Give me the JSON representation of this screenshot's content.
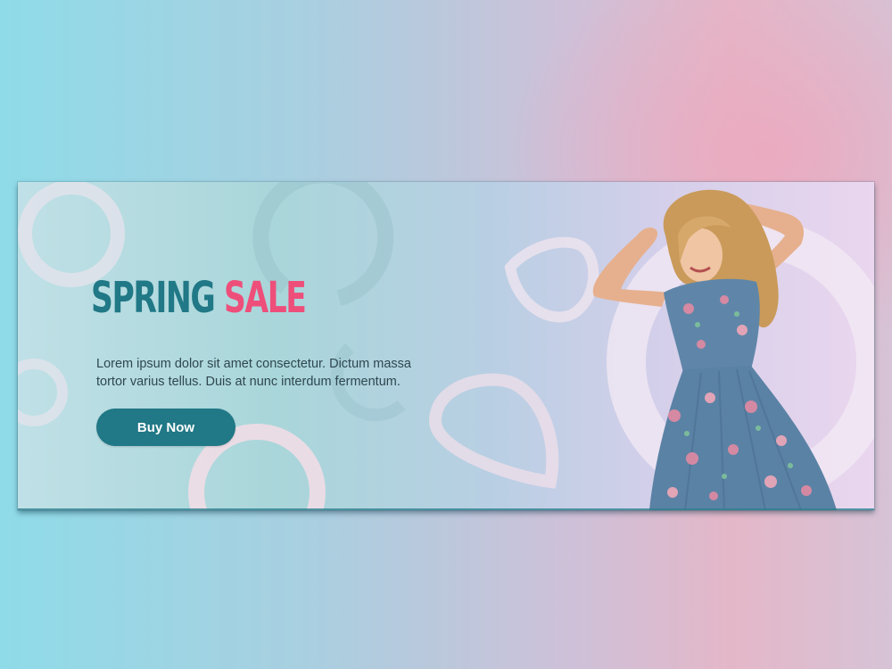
{
  "banner": {
    "headline_part1": "SPRING",
    "headline_part2": "SALE",
    "body_text": "Lorem ipsum dolor sit amet consectetur. Dictum massa tortor varius tellus. Duis at nunc interdum fermentum.",
    "cta_label": "Buy Now"
  },
  "colors": {
    "primary_teal": "#217886",
    "accent_pink": "#ee4f7a",
    "body_text": "#2f4750"
  },
  "image": {
    "subject": "model-photo"
  }
}
